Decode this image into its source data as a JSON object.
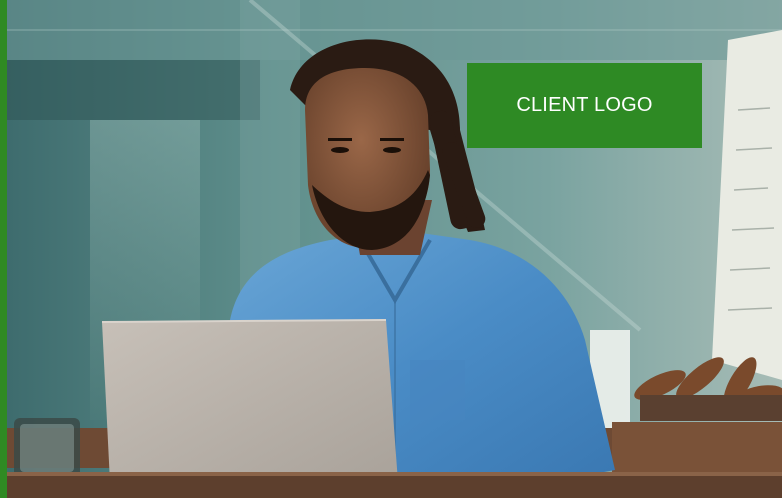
{
  "logo": {
    "label": "CLIENT LOGO"
  },
  "colors": {
    "accent_green": "#2e8a24"
  }
}
